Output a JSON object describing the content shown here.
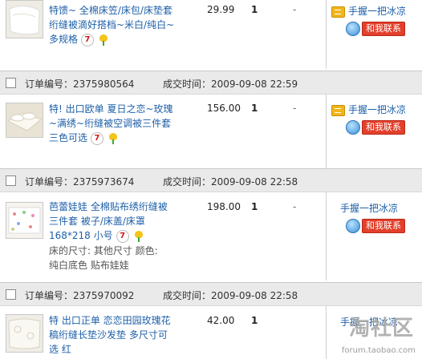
{
  "labels": {
    "order_no_label": "订单编号：",
    "time_label": "成交时间：",
    "dash": "-",
    "contact_button": "和我联系"
  },
  "seller_name": "手握一把冰凉",
  "watermark": {
    "logo_text": "淘社区",
    "url_text": "forum.taobao.com"
  },
  "orders": [
    {
      "title_lines": [
        "特馈~ 全棉床笠/床包/床垫套",
        "绗缝被滴好搭档~米白/纯白~",
        "多规格"
      ],
      "price": "29.99",
      "qty": "1"
    },
    {
      "order_no": "2375980564",
      "time": "2009-09-08 22:59",
      "title_lines": [
        "特! 出口欧单 夏日之恋~玫瑰",
        "~满绣~绗缝被空调被三件套",
        "三色可选"
      ],
      "price": "156.00",
      "qty": "1"
    },
    {
      "order_no": "2375973674",
      "time": "2009-09-08 22:58",
      "title_lines": [
        "芭蕾娃娃 全棉贴布绣绗缝被",
        "三件套 被子/床盖/床罩",
        "168*218 小号"
      ],
      "sub_lines": [
        "床的尺寸: 其他尺寸    颜色:",
        "纯白底色 贴布娃娃"
      ],
      "price": "198.00",
      "qty": "1"
    },
    {
      "order_no": "2375970092",
      "time": "2009-09-08 22:58",
      "title_lines": [
        "特 出口正单 恋恋田园玫瑰花",
        "稿绗缝长垫沙发垫 多尺寸可",
        "选 红"
      ],
      "price": "42.00",
      "qty": "1"
    }
  ]
}
